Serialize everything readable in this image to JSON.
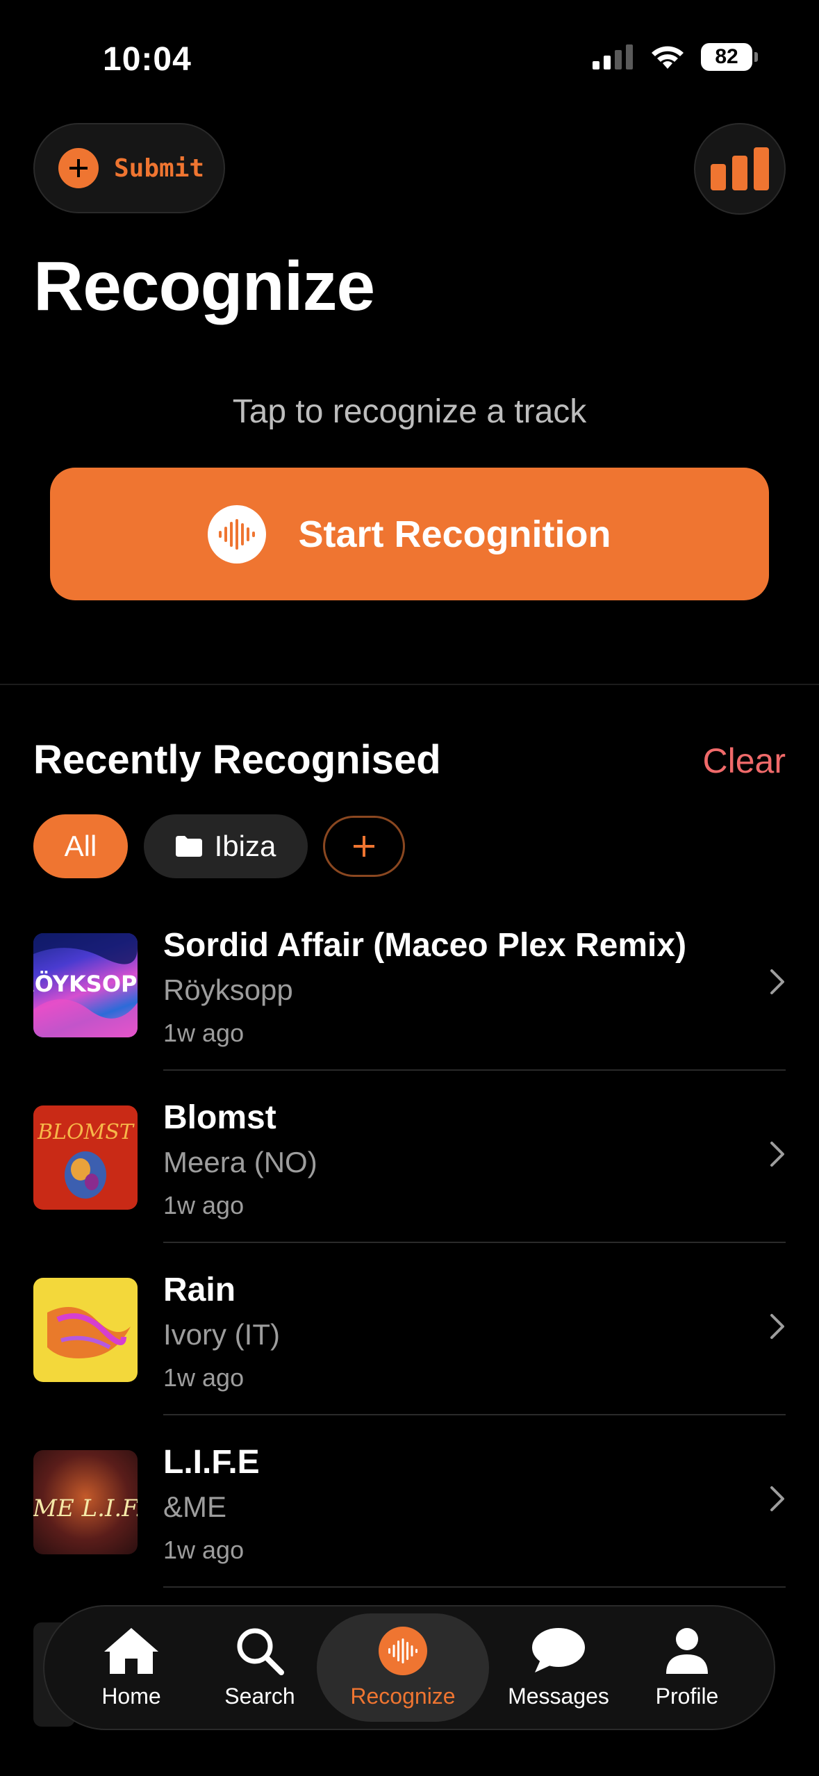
{
  "status_bar": {
    "time": "10:04",
    "battery": "82"
  },
  "header": {
    "submit_label": "Submit",
    "title": "Recognize"
  },
  "recognize": {
    "hint": "Tap to recognize a track",
    "button_label": "Start Recognition"
  },
  "recent": {
    "title": "Recently Recognised",
    "clear_label": "Clear",
    "filters": [
      {
        "label": "All",
        "active": true
      },
      {
        "label": "Ibiza",
        "active": false
      }
    ],
    "items": [
      {
        "title": "Sordid Affair (Maceo Plex Remix)",
        "artist": "Röyksopp",
        "time": "1w ago",
        "art_text": "RÖYKSOPP"
      },
      {
        "title": "Blomst",
        "artist": "Meera (NO)",
        "time": "1w ago",
        "art_text": "BLOMST"
      },
      {
        "title": "Rain",
        "artist": "Ivory (IT)",
        "time": "1w ago",
        "art_text": ""
      },
      {
        "title": "L.I.F.E",
        "artist": "&ME",
        "time": "1w ago",
        "art_text": "&ME L.I.F.E"
      }
    ]
  },
  "tabbar": {
    "tabs": [
      {
        "label": "Home",
        "icon": "home-icon"
      },
      {
        "label": "Search",
        "icon": "search-icon"
      },
      {
        "label": "Recognize",
        "icon": "waveform-icon",
        "active": true
      },
      {
        "label": "Messages",
        "icon": "message-bubble-icon"
      },
      {
        "label": "Profile",
        "icon": "person-icon"
      }
    ]
  },
  "colors": {
    "accent": "#ef7531",
    "danger": "#f06a6a",
    "background": "#000000"
  }
}
